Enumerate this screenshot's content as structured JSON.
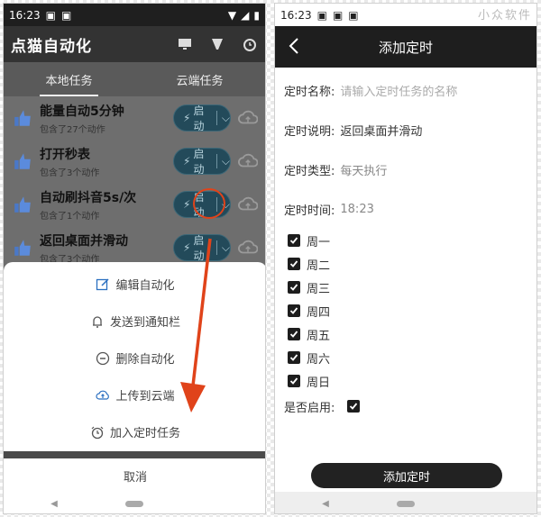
{
  "left": {
    "status": {
      "time": "16:23"
    },
    "app_title": "点猫自动化",
    "tabs": [
      {
        "label": "本地任务"
      },
      {
        "label": "云端任务"
      }
    ],
    "tasks": [
      {
        "name": "能量自动5分钟",
        "sub": "包含了27个动作",
        "start": "启动"
      },
      {
        "name": "打开秒表",
        "sub": "包含了3个动作",
        "start": "启动"
      },
      {
        "name": "自动刷抖音5s/次",
        "sub": "包含了1个动作",
        "start": "启动"
      },
      {
        "name": "返回桌面并滑动",
        "sub": "包含了3个动作",
        "start": "启动"
      }
    ],
    "sheet": [
      {
        "label": "编辑自动化",
        "icon": "edit-icon"
      },
      {
        "label": "发送到通知栏",
        "icon": "bell-icon"
      },
      {
        "label": "删除自动化",
        "icon": "minus-circle-icon"
      },
      {
        "label": "上传到云端",
        "icon": "cloud-upload-icon"
      },
      {
        "label": "加入定时任务",
        "icon": "alarm-icon"
      }
    ],
    "cancel": "取消"
  },
  "right": {
    "status": {
      "time": "16:23"
    },
    "title": "添加定时",
    "form": {
      "name_label": "定时名称:",
      "name_placeholder": "请输入定时任务的名称",
      "desc_label": "定时说明:",
      "desc_value": "返回桌面并滑动",
      "type_label": "定时类型:",
      "type_value": "每天执行",
      "time_label": "定时时间:",
      "time_value": "18:23"
    },
    "days": [
      "周一",
      "周二",
      "周三",
      "周四",
      "周五",
      "周六",
      "周日"
    ],
    "enable_label": "是否启用:",
    "submit": "添加定时"
  },
  "watermark": "小众软件",
  "colors": {
    "accent_red": "#e0431a",
    "dark": "#1e1e1e",
    "start_bg": "#234a5a"
  }
}
